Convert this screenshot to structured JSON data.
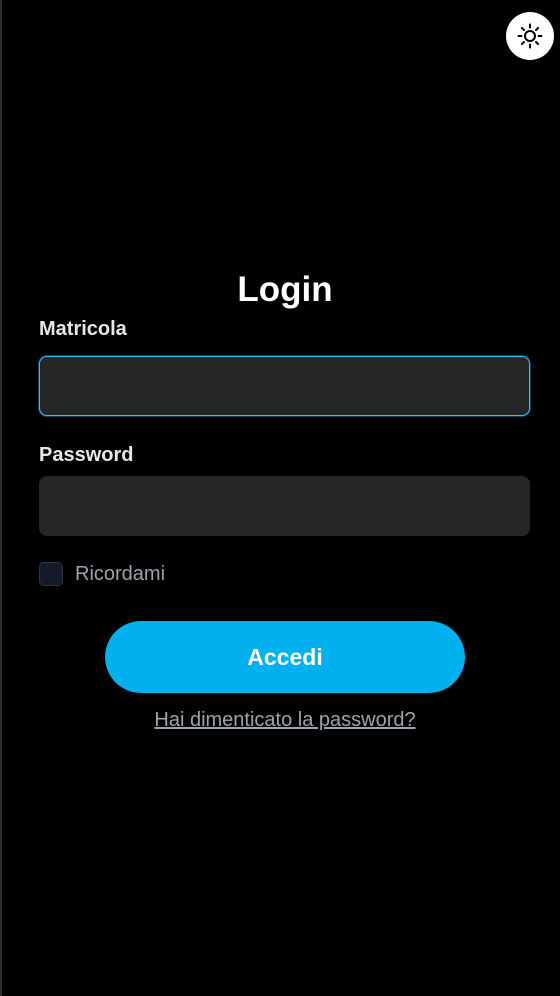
{
  "theme_toggle": {
    "icon": "sun-icon"
  },
  "login": {
    "title": "Login",
    "matricola_label": "Matricola",
    "matricola_value": "",
    "password_label": "Password",
    "password_value": "",
    "remember_label": "Ricordami",
    "remember_checked": false,
    "submit_label": "Accedi",
    "forgot_label": "Hai dimenticato la password?"
  },
  "colors": {
    "background": "#000000",
    "accent": "#00b0ef",
    "focus_border": "#38bdf8",
    "input_bg": "#262626",
    "muted_text": "#9ca3af"
  }
}
